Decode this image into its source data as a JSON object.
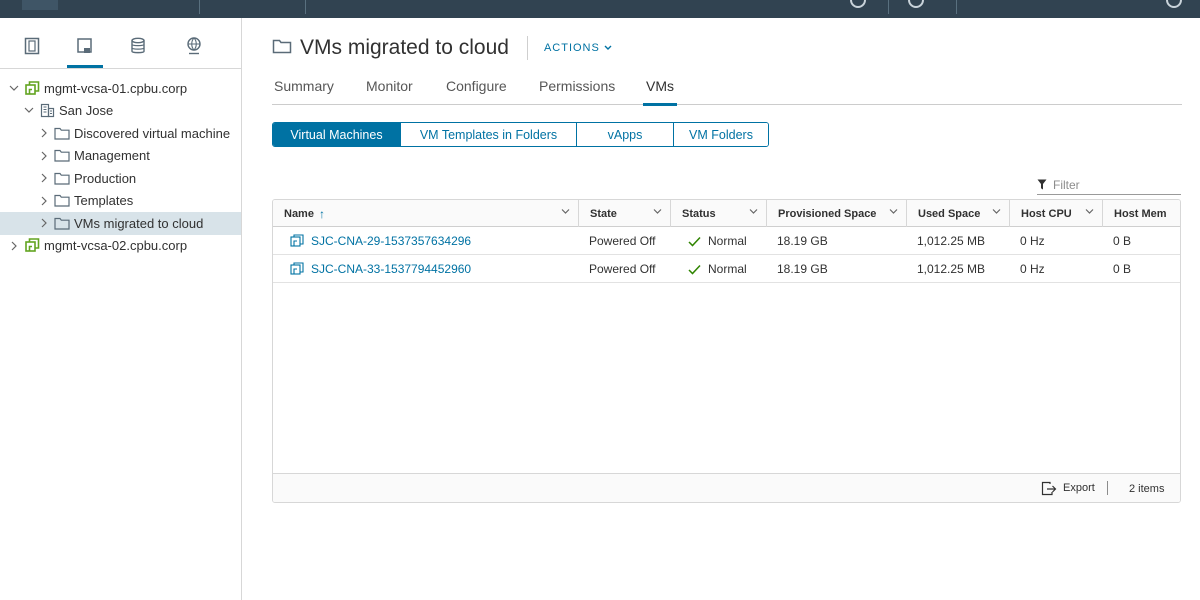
{
  "page": {
    "title": "VMs migrated to cloud",
    "actions_label": "ACTIONS"
  },
  "tabs": [
    {
      "label": "Summary"
    },
    {
      "label": "Monitor"
    },
    {
      "label": "Configure"
    },
    {
      "label": "Permissions"
    },
    {
      "label": "VMs",
      "active": true
    }
  ],
  "subtabs": [
    {
      "label": "Virtual Machines",
      "active": true
    },
    {
      "label": "VM Templates in Folders"
    },
    {
      "label": "vApps"
    },
    {
      "label": "VM Folders"
    }
  ],
  "tree": [
    {
      "label": "mgmt-vcsa-01.cpbu.corp",
      "level": 0,
      "expanded": true,
      "icon": "vcenter-icon"
    },
    {
      "label": "San Jose",
      "level": 1,
      "expanded": true,
      "icon": "datacenter-icon"
    },
    {
      "label": "Discovered virtual machine",
      "level": 2,
      "expanded": false,
      "icon": "folder-icon"
    },
    {
      "label": "Management",
      "level": 2,
      "expanded": false,
      "icon": "folder-icon"
    },
    {
      "label": "Production",
      "level": 2,
      "expanded": false,
      "icon": "folder-icon"
    },
    {
      "label": "Templates",
      "level": 2,
      "expanded": false,
      "icon": "folder-icon"
    },
    {
      "label": "VMs migrated to cloud",
      "level": 2,
      "expanded": false,
      "icon": "folder-icon",
      "selected": true
    },
    {
      "label": "mgmt-vcsa-02.cpbu.corp",
      "level": 0,
      "expanded": false,
      "icon": "vcenter-icon"
    }
  ],
  "filter": {
    "placeholder": "Filter"
  },
  "grid": {
    "columns": [
      "Name",
      "State",
      "Status",
      "Provisioned Space",
      "Used Space",
      "Host CPU",
      "Host Mem"
    ],
    "sort_indicator": "↑",
    "rows": [
      {
        "name": "SJC-CNA-29-1537357634296",
        "state": "Powered Off",
        "status": "Normal",
        "provisioned": "18.19 GB",
        "used": "1,012.25 MB",
        "cpu": "0 Hz",
        "mem": "0 B"
      },
      {
        "name": "SJC-CNA-33-1537794452960",
        "state": "Powered Off",
        "status": "Normal",
        "provisioned": "18.19 GB",
        "used": "1,012.25 MB",
        "cpu": "0 Hz",
        "mem": "0 B"
      }
    ],
    "export_label": "Export",
    "items_label": "2 items"
  },
  "colors": {
    "accent": "#0072a3",
    "topbar": "#314351",
    "status_ok": "#2f8400",
    "tree_selected": "#d8e3e9",
    "vcenter_icon": "#62a420"
  }
}
